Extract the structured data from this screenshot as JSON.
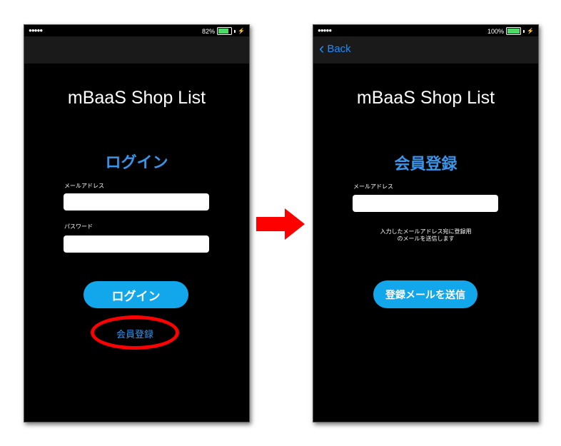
{
  "left_screen": {
    "status": {
      "signal": "●●●●●",
      "battery": "82%",
      "battery_fraction": 0.82
    },
    "app_title": "mBaaS Shop List",
    "screen_title": "ログイン",
    "email_label": "メールアドレス",
    "password_label": "パスワード",
    "login_button": "ログイン",
    "register_link": "会員登録"
  },
  "right_screen": {
    "status": {
      "signal": "●●●●●",
      "battery": "100%",
      "battery_fraction": 1.0
    },
    "back_label": "Back",
    "app_title": "mBaaS Shop List",
    "screen_title": "会員登録",
    "email_label": "メールアドレス",
    "hint_line1": "入力したメールアドレス宛に登録用",
    "hint_line2": "のメールを送信します",
    "send_button": "登録メールを送信"
  },
  "colors": {
    "accent_blue": "#3a95ea",
    "button_blue": "#12a6ea",
    "highlight_red": "#ff0000",
    "arrow_red": "#ff0000",
    "battery_green": "#4cd964"
  }
}
